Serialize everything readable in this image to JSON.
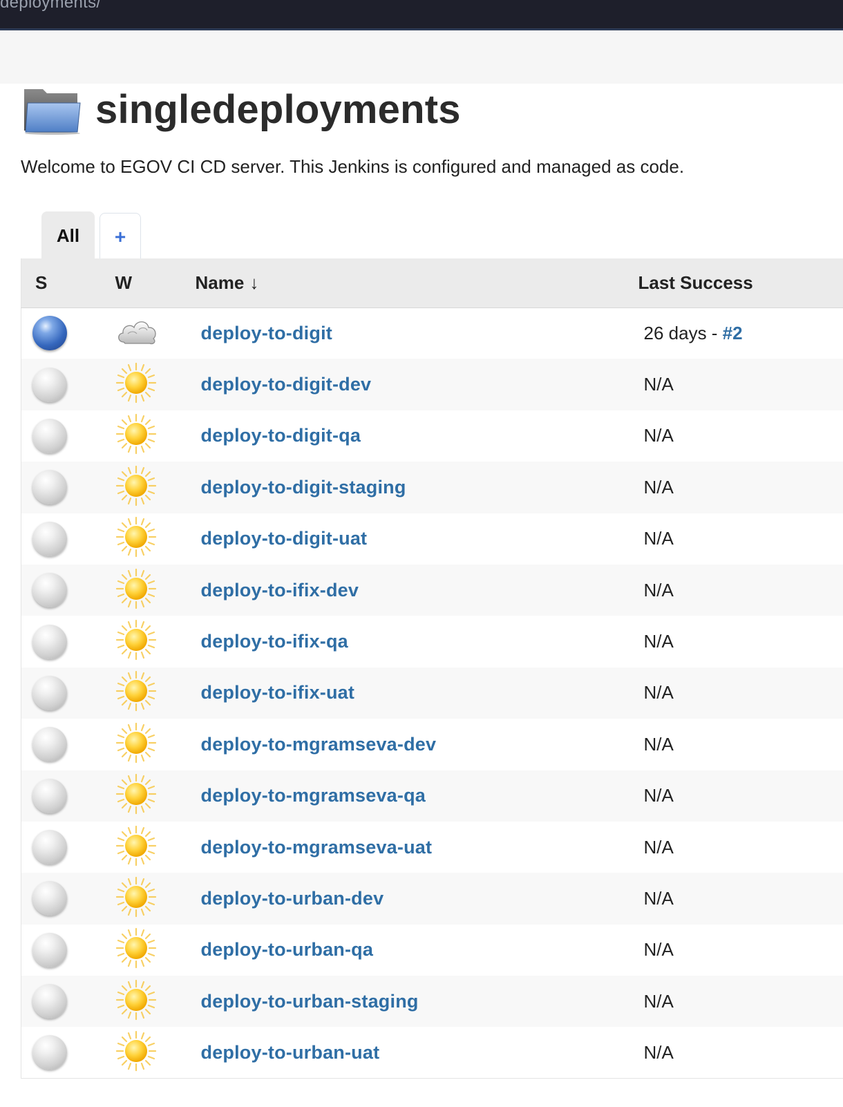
{
  "topbar": {
    "breadcrumb": "deployments/"
  },
  "page": {
    "title": "singledeployments",
    "description": "Welcome to EGOV CI CD server.  This Jenkins is configured and managed as code."
  },
  "tabs": {
    "all_label": "All",
    "add_label": "+"
  },
  "table": {
    "headers": {
      "status": "S",
      "weather": "W",
      "name": "Name",
      "name_sort": "↓",
      "last_success": "Last Success"
    },
    "rows": [
      {
        "status": "blue",
        "weather": "cloudy",
        "name": "deploy-to-digit",
        "last_success": "26 days - ",
        "build": "#2"
      },
      {
        "status": "grey",
        "weather": "sunny",
        "name": "deploy-to-digit-dev",
        "last_success": "N/A"
      },
      {
        "status": "grey",
        "weather": "sunny",
        "name": "deploy-to-digit-qa",
        "last_success": "N/A"
      },
      {
        "status": "grey",
        "weather": "sunny",
        "name": "deploy-to-digit-staging",
        "last_success": "N/A"
      },
      {
        "status": "grey",
        "weather": "sunny",
        "name": "deploy-to-digit-uat",
        "last_success": "N/A"
      },
      {
        "status": "grey",
        "weather": "sunny",
        "name": "deploy-to-ifix-dev",
        "last_success": "N/A"
      },
      {
        "status": "grey",
        "weather": "sunny",
        "name": "deploy-to-ifix-qa",
        "last_success": "N/A"
      },
      {
        "status": "grey",
        "weather": "sunny",
        "name": "deploy-to-ifix-uat",
        "last_success": "N/A"
      },
      {
        "status": "grey",
        "weather": "sunny",
        "name": "deploy-to-mgramseva-dev",
        "last_success": "N/A"
      },
      {
        "status": "grey",
        "weather": "sunny",
        "name": "deploy-to-mgramseva-qa",
        "last_success": "N/A"
      },
      {
        "status": "grey",
        "weather": "sunny",
        "name": "deploy-to-mgramseva-uat",
        "last_success": "N/A"
      },
      {
        "status": "grey",
        "weather": "sunny",
        "name": "deploy-to-urban-dev",
        "last_success": "N/A"
      },
      {
        "status": "grey",
        "weather": "sunny",
        "name": "deploy-to-urban-qa",
        "last_success": "N/A"
      },
      {
        "status": "grey",
        "weather": "sunny",
        "name": "deploy-to-urban-staging",
        "last_success": "N/A"
      },
      {
        "status": "grey",
        "weather": "sunny",
        "name": "deploy-to-urban-uat",
        "last_success": "N/A"
      }
    ]
  },
  "icons": {
    "folder": "folder-icon",
    "status_blue": "status-success-ball-icon",
    "status_grey": "status-notbuilt-ball-icon",
    "weather_sunny": "sun-weather-icon",
    "weather_cloudy": "cloud-weather-icon"
  },
  "colors": {
    "link": "#2f6ea5",
    "tab_add": "#3a6fd6",
    "header_bg": "#ebebeb",
    "topbar_bg": "#1e1f2b"
  }
}
